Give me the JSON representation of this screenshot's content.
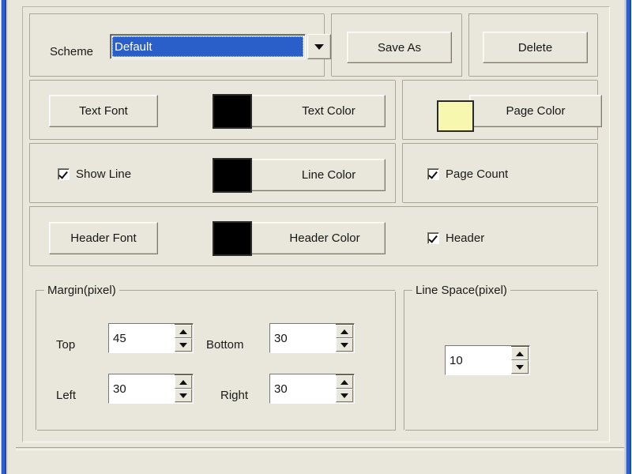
{
  "window": {
    "background_color": "#E9E7DB",
    "border_color": "#2f5fd0"
  },
  "scheme_row": {
    "label": "Scheme",
    "combo": {
      "value": "Default",
      "arrow_icon": "chevron-down-icon"
    },
    "save_as_label": "Save As",
    "delete_label": "Delete"
  },
  "text_row": {
    "text_font_label": "Text Font",
    "text_color_label": "Text Color",
    "text_color_swatch": "#000000",
    "page_color_label": "Page Color",
    "page_color_swatch": "#F7F7B0"
  },
  "line_row": {
    "show_line_label": "Show Line",
    "show_line_checked": "checked",
    "line_color_label": "Line Color",
    "line_color_swatch": "#000000",
    "page_count_label": "Page Count",
    "page_count_checked": "checked"
  },
  "header_row": {
    "header_font_label": "Header Font",
    "header_color_label": "Header Color",
    "header_color_swatch": "#000000",
    "header_label": "Header",
    "header_checked": "checked"
  },
  "margin_group": {
    "caption": "Margin(pixel)",
    "fields": [
      {
        "label": "Top",
        "value": "45"
      },
      {
        "label": "Bottom",
        "value": "30"
      },
      {
        "label": "Left",
        "value": "30"
      },
      {
        "label": "Right",
        "value": "30"
      }
    ]
  },
  "line_space_group": {
    "caption": "Line Space(pixel)",
    "value": "10"
  },
  "icons": {
    "spin_up": "triangle-up-icon",
    "spin_down": "triangle-down-icon"
  }
}
